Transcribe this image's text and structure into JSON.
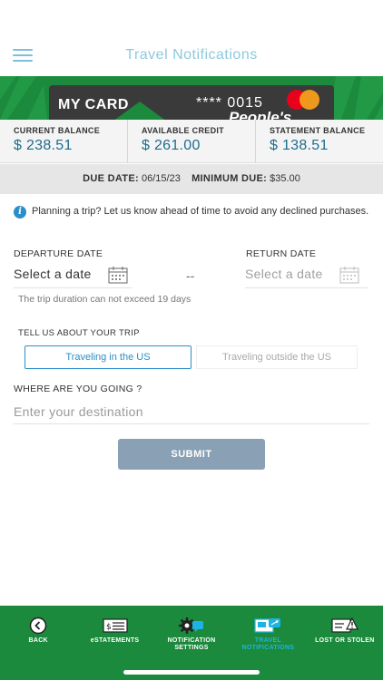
{
  "header": {
    "title": "Travel Notifications"
  },
  "card": {
    "name": "MY CARD",
    "number": "**** 0015",
    "brand_text": "People's"
  },
  "balances": [
    {
      "label": "CURRENT BALANCE",
      "value": "$ 238.51"
    },
    {
      "label": "AVAILABLE CREDIT",
      "value": "$ 261.00"
    },
    {
      "label": "STATEMENT BALANCE",
      "value": "$ 138.51"
    }
  ],
  "due": {
    "due_label": "DUE DATE:",
    "due_value": "06/15/23",
    "min_label": "MINIMUM DUE:",
    "min_value": "$35.00"
  },
  "info": {
    "text": "Planning a trip? Let us know ahead of time to avoid any declined purchases."
  },
  "form": {
    "departure_label": "DEPARTURE DATE",
    "departure_placeholder": "Select a date",
    "separator": "--",
    "return_label": "RETURN DATE",
    "return_placeholder": "Select a date",
    "hint": "The trip duration can not exceed 19 days",
    "trip_label": "TELL US ABOUT YOUR TRIP",
    "trip_options": [
      "Traveling in the US",
      "Traveling outside the US"
    ],
    "where_label": "WHERE ARE YOU GOING ?",
    "destination_placeholder": "Enter your destination",
    "submit_label": "SUBMIT"
  },
  "nav": [
    {
      "label": "BACK",
      "icon": "back-icon"
    },
    {
      "label": "eSTATEMENTS",
      "icon": "statement-icon"
    },
    {
      "label": "NOTIFICATION SETTINGS",
      "icon": "notification-settings-icon"
    },
    {
      "label": "TRAVEL NOTIFICATIONS",
      "icon": "travel-icon",
      "active": true
    },
    {
      "label": "LOST OR STOLEN",
      "icon": "lost-card-icon"
    }
  ],
  "colors": {
    "brand_green": "#1c8a3c",
    "accent_blue": "#2a8fc8",
    "title_blue": "#8ec9dd",
    "active_nav": "#1db3e6"
  }
}
